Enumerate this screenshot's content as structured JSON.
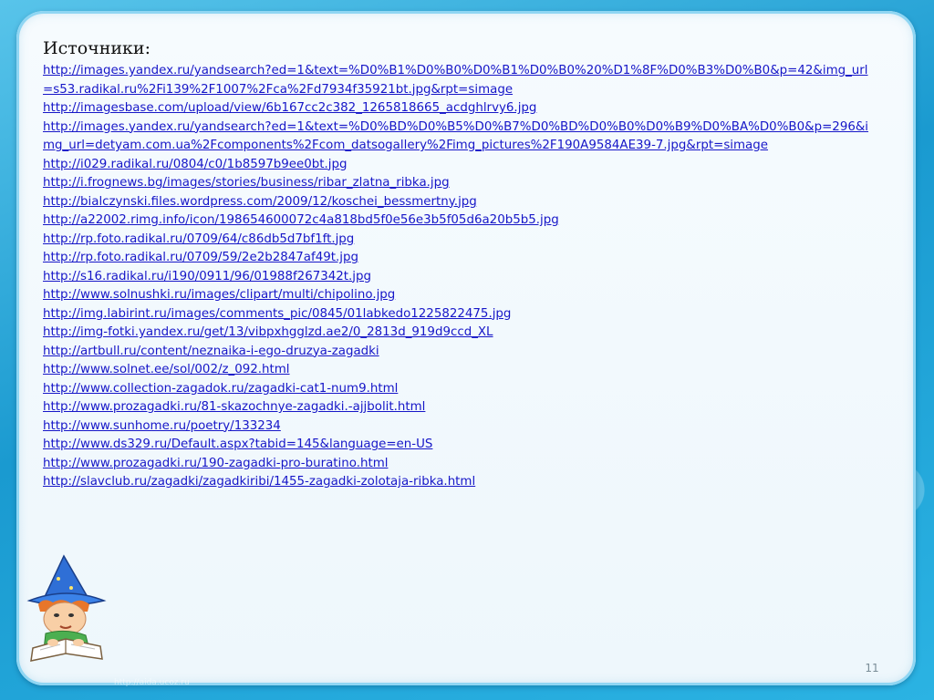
{
  "slide": {
    "heading": "Источники:",
    "links": [
      "http://images.yandex.ru/yandsearch?ed=1&text=%D0%B1%D0%B0%D0%B1%D0%B0%20%D1%8F%D0%B3%D0%B0&p=42&img_url=s53.radikal.ru%2Fi139%2F1007%2Fca%2Fd7934f35921bt.jpg&rpt=simage",
      "http://imagesbase.com/upload/view/6b167cc2c382_1265818665_acdghlrvy6.jpg",
      "http://images.yandex.ru/yandsearch?ed=1&text=%D0%BD%D0%B5%D0%B7%D0%BD%D0%B0%D0%B9%D0%BA%D0%B0&p=296&img_url=detyam.com.ua%2Fcomponents%2Fcom_datsogallery%2Fimg_pictures%2F190A9584AE39-7.jpg&rpt=simage",
      "http://i029.radikal.ru/0804/c0/1b8597b9ee0bt.jpg",
      "http://i.frognews.bg/images/stories/business/ribar_zlatna_ribka.jpg",
      "http://bialczynski.files.wordpress.com/2009/12/koschei_bessmertny.jpg",
      "http://a22002.rimg.info/icon/198654600072c4a818bd5f0e56e3b5f05d6a20b5b5.jpg",
      "http://rp.foto.radikal.ru/0709/64/c86db5d7bf1ft.jpg",
      "http://rp.foto.radikal.ru/0709/59/2e2b2847af49t.jpg",
      "http://s16.radikal.ru/i190/0911/96/01988f267342t.jpg",
      "http://www.solnushki.ru/images/clipart/multi/chipolino.jpg",
      "http://img.labirint.ru/images/comments_pic/0845/01labkedo1225822475.jpg",
      "http://img-fotki.yandex.ru/get/13/vibpxhgglzd.ae2/0_2813d_919d9ccd_XL",
      "http://artbull.ru/content/neznaika-i-ego-druzya-zagadki",
      "http://www.solnet.ee/sol/002/z_092.html",
      "http://www.collection-zagadok.ru/zagadki-cat1-num9.html",
      "http://www.prozagadki.ru/81-skazochnye-zagadki.-ajjbolit.html",
      "http://www.sunhome.ru/poetry/133234",
      "http://www.ds329.ru/Default.aspx?tabid=145&language=en-US",
      "http://www.prozagadki.ru/190-zagadki-pro-buratino.html",
      "http://slavclub.ru/zagadki/zagadkiribi/1455-zagadki-zolotaja-ribka.html"
    ],
    "slide_number": "11",
    "watermark": "http://aida.ucoz.ru"
  },
  "colors": {
    "link": "#1616c8",
    "frame": "#1e9fd2",
    "card": "#f3f9fd"
  },
  "icons": {
    "mascot": "wizard-child-reading-icon"
  }
}
